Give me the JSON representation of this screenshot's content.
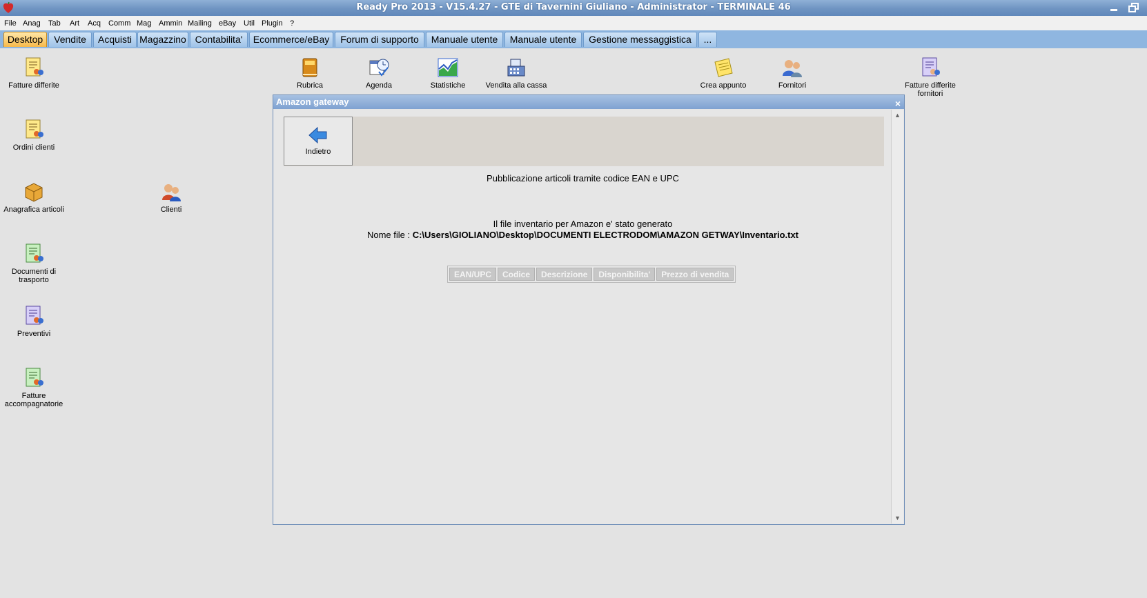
{
  "window": {
    "title": "Ready Pro 2013 - V15.4.27 - GTE di Tavernini Giuliano - Administrator - TERMINALE 46"
  },
  "menu": [
    "File",
    "Anag",
    "Tab",
    "Art",
    "Acq",
    "Comm",
    "Mag",
    "Ammin",
    "Mailing",
    "eBay",
    "Util",
    "Plugin",
    "?"
  ],
  "tabs": [
    "Desktop",
    "Vendite",
    "Acquisti",
    "Magazzino",
    "Contabilita'",
    "Ecommerce/eBay",
    "Forum di supporto",
    "Manuale utente",
    "Manuale utente",
    "Gestione messaggistica",
    "..."
  ],
  "desktop_icons": {
    "fatture_differite": "Fatture differite",
    "ordini_clienti": "Ordini clienti",
    "anagrafica_articoli": "Anagrafica articoli",
    "clienti": "Clienti",
    "documenti_trasporto": "Documenti di trasporto",
    "preventivi": "Preventivi",
    "fatture_accompagnatorie": "Fatture accompagnatorie",
    "rubrica": "Rubrica",
    "agenda": "Agenda",
    "statistiche": "Statistiche",
    "vendita_cassa": "Vendita alla cassa",
    "crea_appunto": "Crea appunto",
    "fornitori": "Fornitori",
    "fatture_differite_fornitori": "Fatture differite fornitori"
  },
  "dialog": {
    "title": "Amazon gateway",
    "close_label": "×",
    "back_label": "Indietro",
    "heading": "Pubblicazione articoli tramite codice EAN e UPC",
    "status": "Il file inventario per Amazon e' stato generato",
    "filename_label": "Nome file : ",
    "filename_value": "C:\\Users\\GIOLIANO\\Desktop\\DOCUMENTI ELECTRODOM\\AMAZON GETWAY\\Inventario.txt",
    "columns": [
      "EAN/UPC",
      "Codice",
      "Descrizione",
      "Disponibilita'",
      "Prezzo di vendita"
    ]
  }
}
